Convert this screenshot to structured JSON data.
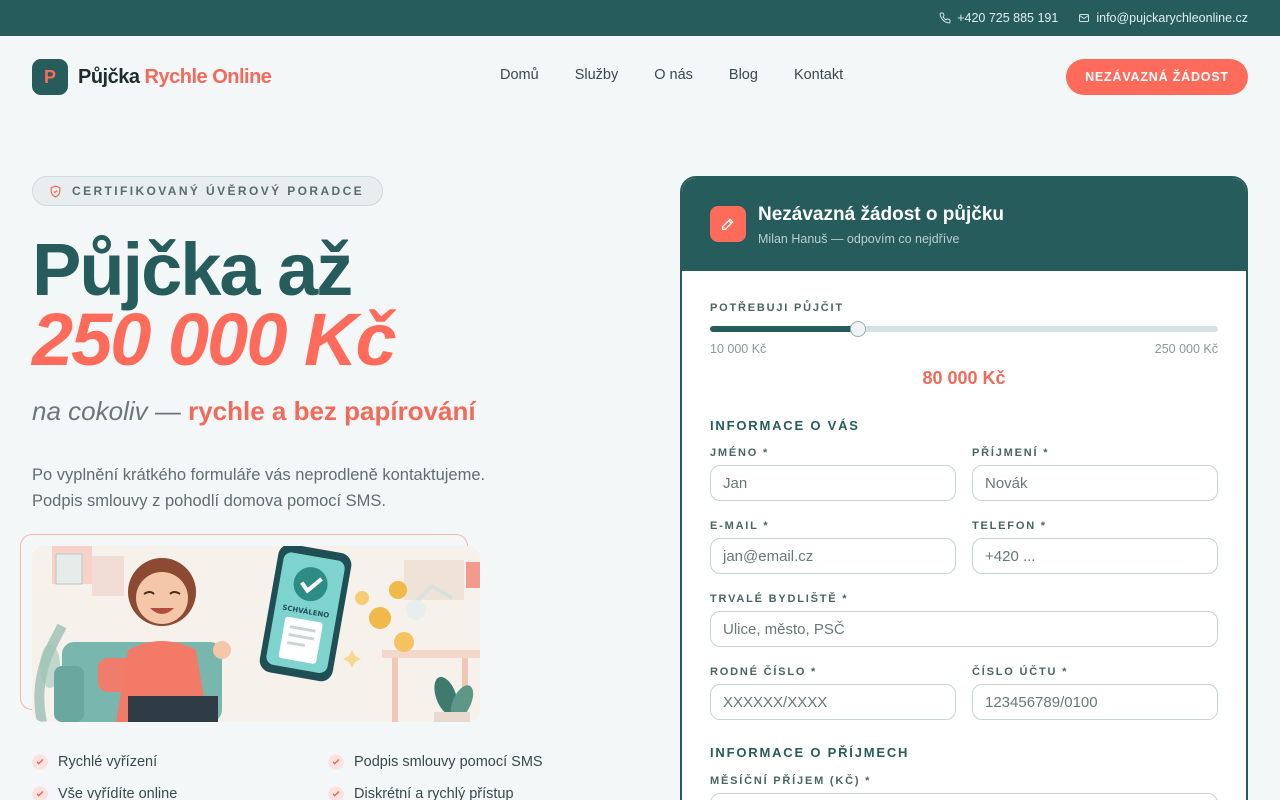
{
  "topbar": {
    "phone": "+420 725 885 191",
    "email": "info@pujckarychleonline.cz",
    "phone_icon": "phone-icon",
    "email_icon": "mail-icon"
  },
  "brand": {
    "mark": "P",
    "name_part1": "Půjčka",
    "name_part2": "Rychle Online"
  },
  "nav": [
    "Domů",
    "Služby",
    "O nás",
    "Blog",
    "Kontakt"
  ],
  "header_cta": "NEZÁVAZNÁ ŽÁDOST",
  "hero": {
    "badge": "CERTIFIKOVANÝ ÚVĚROVÝ PORADCE",
    "title_line1": "Půjčka až",
    "title_line2": "250 000 Kč",
    "subtitle_plain": "na cokoliv —",
    "subtitle_highlight": "rychle a bez papírování",
    "desc_line1": "Po vyplnění krátkého formuláře vás neprodleně kontaktujeme.",
    "desc_line2": "Podpis smlouvy z pohodlí domova pomocí SMS.",
    "illustration_phone_text": "SCHVÁLENO"
  },
  "features": [
    "Rychlé vyřízení",
    "Podpis smlouvy pomocí SMS",
    "Vše vyřídíte online",
    "Diskrétní a rychlý přístup"
  ],
  "form": {
    "title": "Nezávazná žádost o půjčku",
    "subtitle": "Milan Hanuš — odpovím co nejdříve",
    "amount_label": "POTŘEBUJI PŮJČIT",
    "slider_min": "10 000 Kč",
    "slider_max": "250 000 Kč",
    "slider_value": "80 000 Kč",
    "slider_fraction": 0.2917,
    "section_about": "INFORMACE O VÁS",
    "first_name_label": "JMÉNO *",
    "first_name_placeholder": "Jan",
    "last_name_label": "PŘÍJMENÍ *",
    "last_name_placeholder": "Novák",
    "email_label": "E-MAIL *",
    "email_placeholder": "jan@email.cz",
    "phone_label": "TELEFON *",
    "phone_placeholder": "+420 ...",
    "address_label": "TRVALÉ BYDLIŠTĚ *",
    "address_placeholder": "Ulice, město, PSČ",
    "birth_label": "RODNÉ ČÍSLO *",
    "birth_placeholder": "XXXXXX/XXXX",
    "account_label": "ČÍSLO ÚČTU *",
    "account_placeholder": "123456789/0100",
    "section_income": "INFORMACE O PŘÍJMECH",
    "income_label": "MĚSÍČNÍ PŘÍJEM (KČ) *"
  },
  "colors": {
    "primary": "#265c5c",
    "accent": "#ff6b5b",
    "background": "#f4f7f7"
  }
}
